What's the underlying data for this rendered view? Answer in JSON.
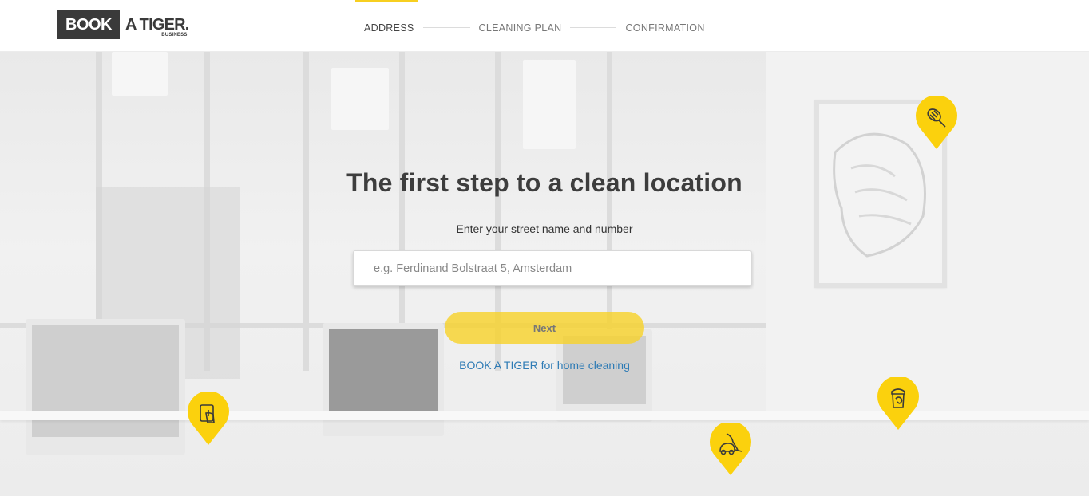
{
  "brand": {
    "logo_box_text": "BOOK",
    "logo_text": "A TIGER.",
    "logo_sub": "BUSINESS"
  },
  "steps": [
    {
      "label": "ADDRESS",
      "active": true
    },
    {
      "label": "CLEANING PLAN",
      "active": false
    },
    {
      "label": "CONFIRMATION",
      "active": false
    }
  ],
  "hero": {
    "title": "The first step to a clean location",
    "address_label": "Enter your street name and number",
    "address_input": {
      "value": "",
      "placeholder": "e.g. Ferdinand Bolstraat 5, Amsterdam"
    },
    "next_label": "Next",
    "home_link": "BOOK A TIGER for home cleaning"
  },
  "pins": [
    {
      "icon": "duster-icon"
    },
    {
      "icon": "tablet-hand-icon"
    },
    {
      "icon": "vacuum-cleaner-icon"
    },
    {
      "icon": "recycle-bin-icon"
    }
  ],
  "colors": {
    "accent": "#f7cf20",
    "pin": "#fbd10d",
    "link": "#2e7bb5",
    "logo_dark": "#3a3a3a"
  }
}
